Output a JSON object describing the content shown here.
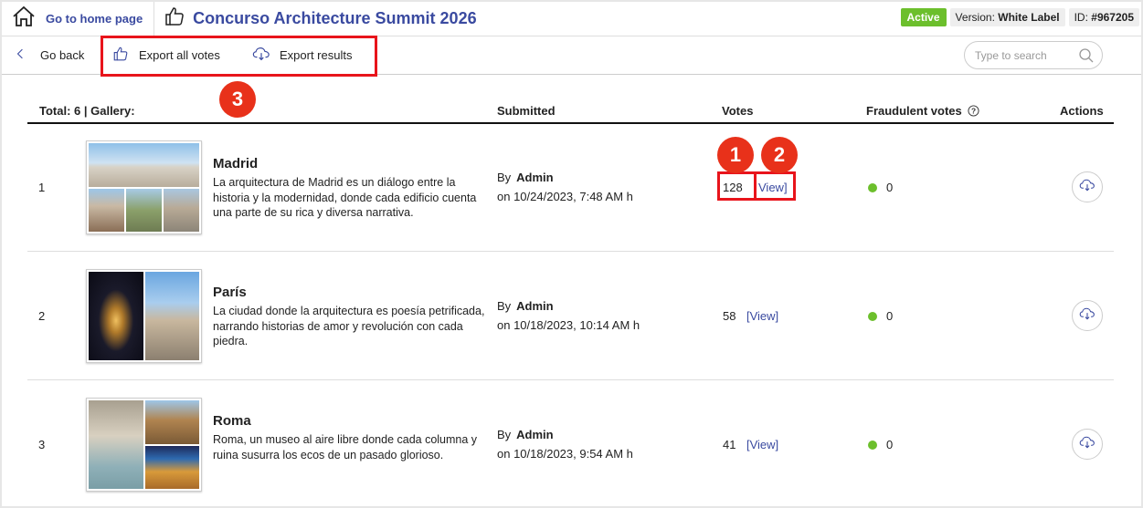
{
  "header": {
    "home_label": "Go to home page",
    "title": "Concurso Architecture Summit 2026",
    "status": "Active",
    "version_label": "Version:",
    "version_value": "White Label",
    "id_label": "ID:",
    "id_value": "#967205"
  },
  "toolbar": {
    "go_back": "Go back",
    "export_votes": "Export all votes",
    "export_results": "Export results",
    "search_placeholder": "Type to search"
  },
  "markers": [
    "1",
    "2",
    "3"
  ],
  "table": {
    "total_label": "Total: 6 | Gallery:",
    "columns": {
      "submitted": "Submitted",
      "votes": "Votes",
      "fraudulent": "Fraudulent votes",
      "actions": "Actions"
    },
    "rows": [
      {
        "index": "1",
        "name": "Madrid",
        "description": "La arquitectura de Madrid es un diálogo entre la historia y la modernidad, donde cada edificio cuenta una parte de su rica y diversa narrativa.",
        "by_label": "By",
        "author": "Admin",
        "date": "on 10/24/2023, 7:48 AM h",
        "votes": "128",
        "view_label": "View]",
        "fraudulent": "0"
      },
      {
        "index": "2",
        "name": "París",
        "description": "La ciudad donde la arquitectura es poesía petrificada, narrando historias de amor y revolución con cada piedra.",
        "by_label": "By",
        "author": "Admin",
        "date": "on 10/18/2023, 10:14 AM h",
        "votes": "58",
        "view_label": "[View]",
        "fraudulent": "0"
      },
      {
        "index": "3",
        "name": "Roma",
        "description": "Roma, un museo al aire libre donde cada columna y ruina susurra los ecos de un pasado glorioso.",
        "by_label": "By",
        "author": "Admin",
        "date": "on 10/18/2023, 9:54 AM h",
        "votes": "41",
        "view_label": "[View]",
        "fraudulent": "0"
      }
    ]
  },
  "colors": {
    "brand": "#3a4aa0",
    "active": "#6cbf2c",
    "annotation": "#e8141b"
  }
}
